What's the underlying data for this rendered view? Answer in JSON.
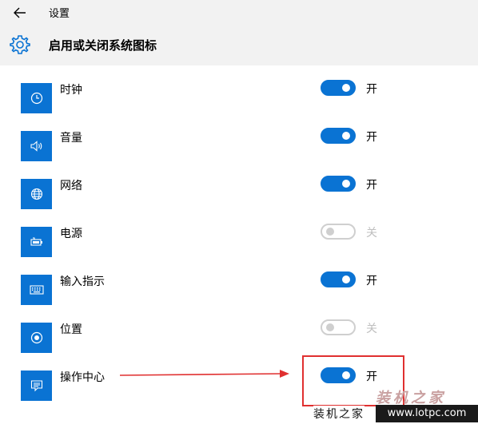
{
  "header": {
    "back_label": "",
    "breadcrumb": "设置",
    "title": "启用或关闭系统图标"
  },
  "colors": {
    "accent": "#0a73d3",
    "header_bg": "#f2f2f2",
    "off_text": "#bfbfbf",
    "annotation_red": "#e03030"
  },
  "items": [
    {
      "label": "时钟",
      "icon": "clock-icon",
      "on": true,
      "state": "开"
    },
    {
      "label": "音量",
      "icon": "volume-icon",
      "on": true,
      "state": "开"
    },
    {
      "label": "网络",
      "icon": "network-globe-icon",
      "on": true,
      "state": "开"
    },
    {
      "label": "电源",
      "icon": "battery-power-icon",
      "on": false,
      "state": "关"
    },
    {
      "label": "输入指示",
      "icon": "keyboard-icon",
      "on": true,
      "state": "开"
    },
    {
      "label": "位置",
      "icon": "location-icon",
      "on": false,
      "state": "关"
    },
    {
      "label": "操作中心",
      "icon": "action-center-icon",
      "on": true,
      "state": "开"
    }
  ],
  "watermark": {
    "brand_large": "装机之家",
    "brand_small": "装机之家",
    "url": "www.lotpc.com"
  }
}
